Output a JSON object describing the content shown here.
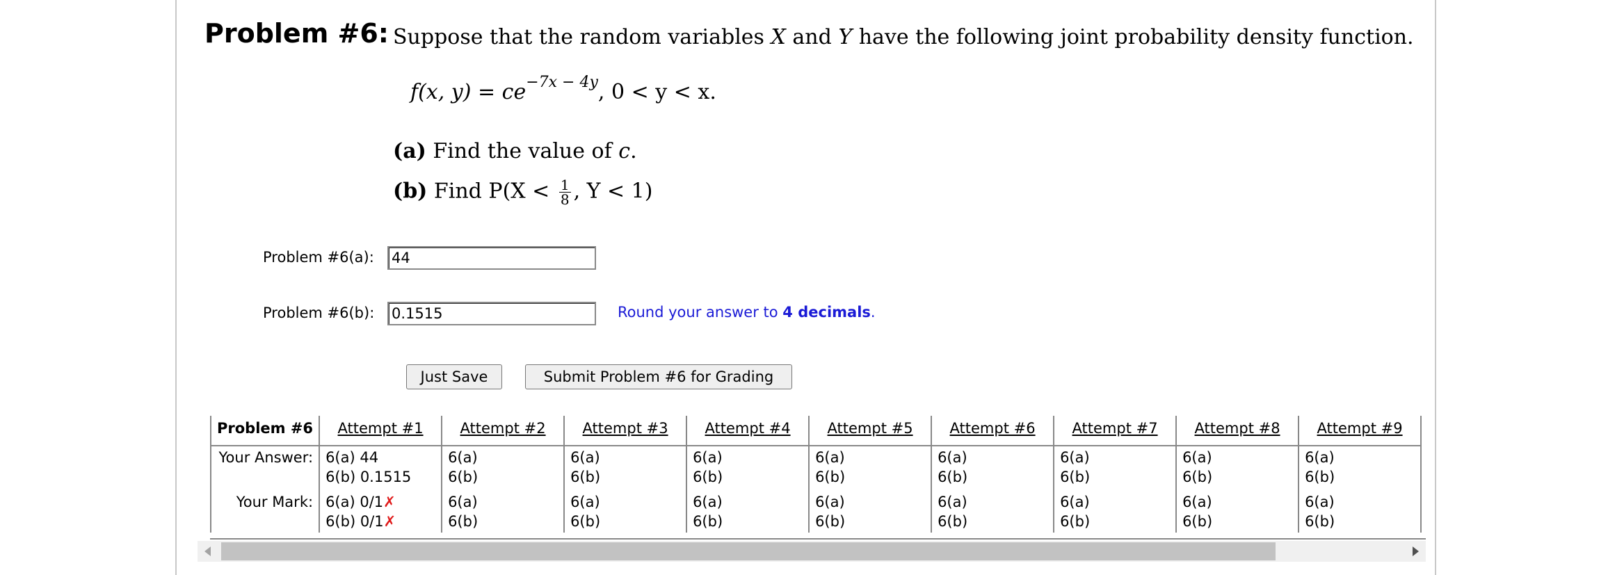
{
  "problem": {
    "title": "Problem #6:",
    "intro_pre": "Suppose that the random variables ",
    "var_x": "X",
    "intro_and": " and ",
    "var_y": "Y",
    "intro_post": " have the following joint probability density function.",
    "formula_lhs": "f(x, y)",
    "formula_eq": " = ce",
    "formula_exp": "−7x − 4y",
    "formula_domain": ",   0 < y < x.",
    "part_a_label": "(a)",
    "part_a_text": " Find the value of ",
    "part_a_var": "c",
    "part_a_end": ".",
    "part_b_label": "(b)",
    "part_b_text": " Find P(X < ",
    "part_b_frac_num": "1",
    "part_b_frac_den": "8",
    "part_b_end": ", Y < 1)"
  },
  "answers": {
    "a_label": "Problem #6(a):",
    "a_value": "44",
    "b_label": "Problem #6(b):",
    "b_value": "0.1515",
    "hint_pre": "Round your answer to ",
    "hint_bold": "4 decimals",
    "hint_post": "."
  },
  "buttons": {
    "save": "Just Save",
    "submit": "Submit Problem #6 for Grading"
  },
  "table": {
    "header": "Problem #6",
    "your_answer_label": "Your Answer:",
    "your_mark_label": "Your Mark:",
    "attempts": [
      {
        "label": "Attempt #1",
        "ans_a": "6(a) 44",
        "ans_b": "6(b) 0.1515",
        "mark_a": "6(a) 0/1",
        "mark_b": "6(b) 0/1",
        "wrong": true
      },
      {
        "label": "Attempt #2",
        "ans_a": "6(a)",
        "ans_b": "6(b)",
        "mark_a": "6(a)",
        "mark_b": "6(b)",
        "wrong": false
      },
      {
        "label": "Attempt #3",
        "ans_a": "6(a)",
        "ans_b": "6(b)",
        "mark_a": "6(a)",
        "mark_b": "6(b)",
        "wrong": false
      },
      {
        "label": "Attempt #4",
        "ans_a": "6(a)",
        "ans_b": "6(b)",
        "mark_a": "6(a)",
        "mark_b": "6(b)",
        "wrong": false
      },
      {
        "label": "Attempt #5",
        "ans_a": "6(a)",
        "ans_b": "6(b)",
        "mark_a": "6(a)",
        "mark_b": "6(b)",
        "wrong": false
      },
      {
        "label": "Attempt #6",
        "ans_a": "6(a)",
        "ans_b": "6(b)",
        "mark_a": "6(a)",
        "mark_b": "6(b)",
        "wrong": false
      },
      {
        "label": "Attempt #7",
        "ans_a": "6(a)",
        "ans_b": "6(b)",
        "mark_a": "6(a)",
        "mark_b": "6(b)",
        "wrong": false
      },
      {
        "label": "Attempt #8",
        "ans_a": "6(a)",
        "ans_b": "6(b)",
        "mark_a": "6(a)",
        "mark_b": "6(b)",
        "wrong": false
      },
      {
        "label": "Attempt #9",
        "ans_a": "6(a)",
        "ans_b": "6(b)",
        "mark_a": "6(a)",
        "mark_b": "6(b)",
        "wrong": false
      }
    ],
    "wrong_mark": "✗"
  },
  "icons": {
    "wrong": "x-mark-icon",
    "scroll_left": "arrow-left-icon",
    "scroll_right": "arrow-right-icon"
  },
  "colors": {
    "hint": "#1a1ad6",
    "wrong": "#e01b1b"
  }
}
